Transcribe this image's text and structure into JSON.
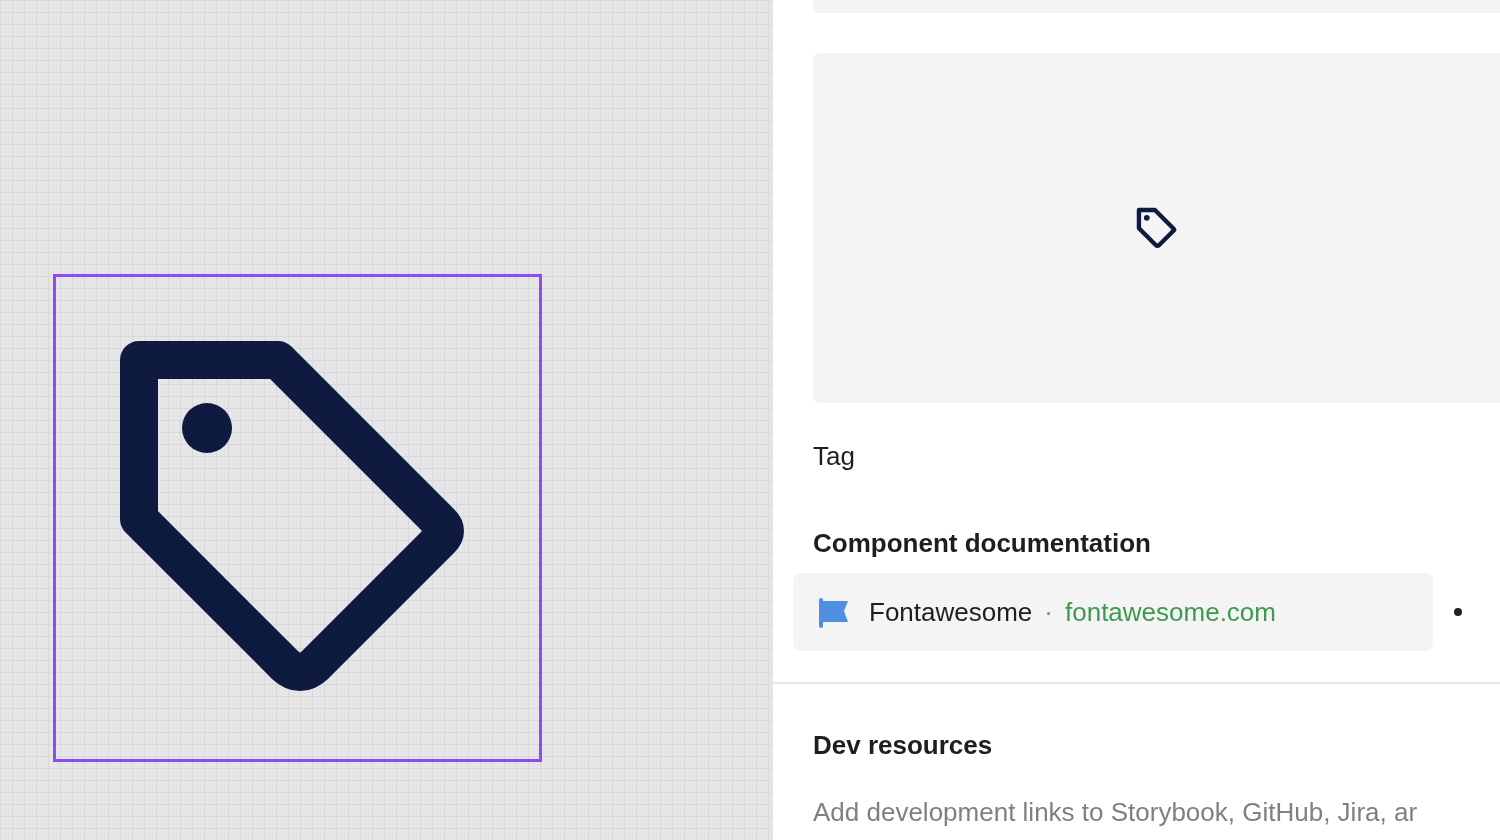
{
  "component_name": "Tag",
  "documentation": {
    "heading": "Component documentation",
    "link": {
      "name": "Fontawesome",
      "separator": "·",
      "url": "fontawesome.com"
    }
  },
  "dev_resources": {
    "heading": "Dev resources",
    "hint": "Add development links to Storybook, GitHub, Jira, ar"
  }
}
